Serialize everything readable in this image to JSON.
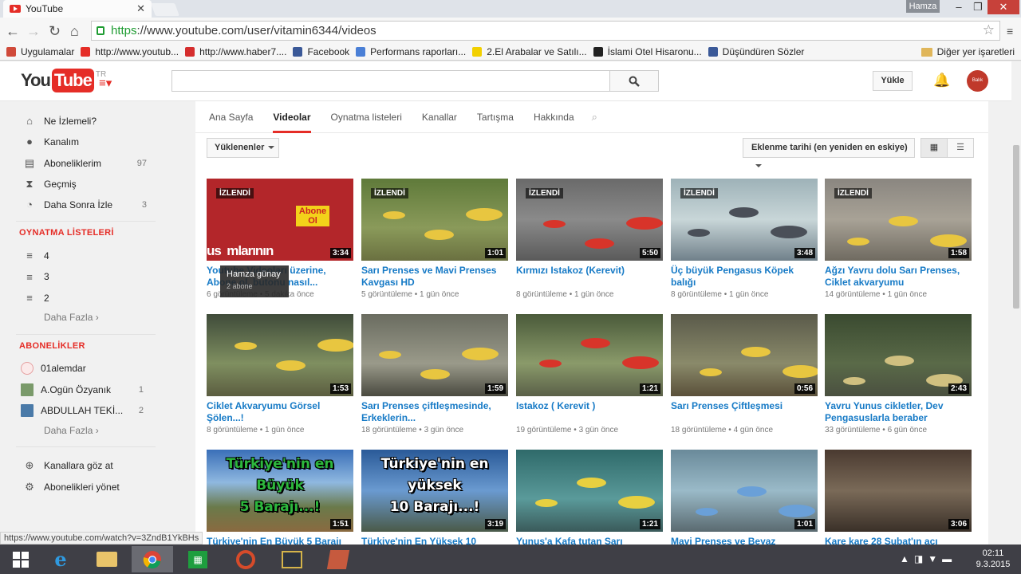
{
  "browser": {
    "tab_title": "YouTube",
    "tab_close": "✕",
    "user_badge": "Hamza",
    "url_https": "https",
    "url_rest": "://www.youtube.com/user/vitamin6344/videos",
    "bookmarks": [
      {
        "label": "Uygulamalar",
        "icon": "apps-icon",
        "color": "#d04a3a"
      },
      {
        "label": "http://www.youtub...",
        "icon": "youtube-icon",
        "color": "#e52d27"
      },
      {
        "label": "http://www.haber7....",
        "icon": "haber7-icon",
        "color": "#d52d2d"
      },
      {
        "label": "Facebook",
        "icon": "facebook-icon",
        "color": "#3b5998"
      },
      {
        "label": "Performans raporları...",
        "icon": "google-icon",
        "color": "#4a7fd6"
      },
      {
        "label": "2.El Arabalar ve Satılı...",
        "icon": "sahibinden-icon",
        "color": "#f2d000"
      },
      {
        "label": "İslami Otel Hisaronu...",
        "icon": "otel-icon",
        "color": "#222222"
      },
      {
        "label": "Düşündüren Sözler",
        "icon": "facebook-icon",
        "color": "#3b5998"
      }
    ],
    "other_bookmarks": "Diğer yer işaretleri",
    "status_url": "https://www.youtube.com/watch?v=3ZndB1YkBHs"
  },
  "masthead": {
    "logo_you": "You",
    "logo_tube": "Tube",
    "logo_region": "TR",
    "search_placeholder": "",
    "upload_label": "Yükle",
    "avatar_text": "Balık Videoları"
  },
  "guide": {
    "main_items": [
      {
        "label": "Ne İzlemeli?",
        "icon": "home-icon",
        "count": ""
      },
      {
        "label": "Kanalım",
        "icon": "user-icon",
        "count": ""
      },
      {
        "label": "Aboneliklerim",
        "icon": "subscriptions-icon",
        "count": "97"
      },
      {
        "label": "Geçmiş",
        "icon": "hourglass-icon",
        "count": ""
      },
      {
        "label": "Daha Sonra İzle",
        "icon": "clock-icon",
        "count": "3"
      }
    ],
    "playlists_header": "OYNATMA LİSTELERİ",
    "playlists": [
      {
        "label": "4"
      },
      {
        "label": "3"
      },
      {
        "label": "2"
      }
    ],
    "more_label": "Daha Fazla",
    "subscriptions_header": "ABONELİKLER",
    "subscriptions": [
      {
        "label": "01alemdar",
        "count": ""
      },
      {
        "label": "A.Ogün Özyanık",
        "count": "1"
      },
      {
        "label": "ABDULLAH TEKİ...",
        "count": "2"
      }
    ],
    "bottom_items": [
      {
        "label": "Kanallara göz at",
        "icon": "plus-circle-icon"
      },
      {
        "label": "Abonelikleri yönet",
        "icon": "gear-icon"
      }
    ]
  },
  "channel": {
    "tabs": [
      "Ana Sayfa",
      "Videolar",
      "Oynatma listeleri",
      "Kanallar",
      "Tartışma",
      "Hakkında"
    ],
    "active_tab": "Videolar",
    "uploads_dropdown": "Yüklenenler",
    "sort_dropdown": "Eklenme tarihi (en yeniden en eskiye)"
  },
  "tooltip": {
    "name": "Hamza günay",
    "subs": "2 abone",
    "button": "Abone Ol"
  },
  "thumb_text": {
    "v1_overlay": "us  mlarının",
    "v11_line1": "Türkiye'nin en",
    "v11_line2": "Büyük",
    "v11_line3": "5 Barajı...!",
    "v12_line1": "Türkiye'nin en",
    "v12_line2": "yüksek",
    "v12_line3": "10 Barajı...!"
  },
  "videos": [
    {
      "title": "Youtube Videoları üzerine, Abone ol, butonu nasıl...",
      "views": "6 görüntüleme",
      "age": "5 dakika önce",
      "duration": "3:34",
      "watched": "İZLENDİ"
    },
    {
      "title": "Sarı Prenses ve Mavi Prenses Kavgası HD",
      "views": "5 görüntüleme",
      "age": "1 gün önce",
      "duration": "1:01",
      "watched": "İZLENDİ"
    },
    {
      "title": "Kırmızı Istakoz (Kerevit)",
      "views": "8 görüntüleme",
      "age": "1 gün önce",
      "duration": "5:50",
      "watched": "İZLENDİ"
    },
    {
      "title": "Üç büyük Pengasus Köpek balığı",
      "views": "8 görüntüleme",
      "age": "1 gün önce",
      "duration": "3:48",
      "watched": "İZLENDİ"
    },
    {
      "title": "Ağzı Yavru dolu Sarı Prenses, Ciklet akvaryumu",
      "views": "14 görüntüleme",
      "age": "1 gün önce",
      "duration": "1:58",
      "watched": "İZLENDİ"
    },
    {
      "title": "Ciklet Akvaryumu Görsel Şölen...!",
      "views": "8 görüntüleme",
      "age": "1 gün önce",
      "duration": "1:53",
      "watched": ""
    },
    {
      "title": "Sarı Prenses çiftleşmesinde, Erkeklerin...",
      "views": "18 görüntüleme",
      "age": "3 gün önce",
      "duration": "1:59",
      "watched": ""
    },
    {
      "title": "Istakoz ( Kerevit )",
      "views": "19 görüntüleme",
      "age": "3 gün önce",
      "duration": "1:21",
      "watched": ""
    },
    {
      "title": "Sarı Prenses Çiftleşmesi",
      "views": "18 görüntüleme",
      "age": "4 gün önce",
      "duration": "0:56",
      "watched": ""
    },
    {
      "title": "Yavru Yunus cikletler, Dev Pengasuslarla beraber",
      "views": "33 görüntüleme",
      "age": "6 gün önce",
      "duration": "2:43",
      "watched": ""
    },
    {
      "title": "Türkiye'nin En Büyük 5 Barajı",
      "views": "",
      "age": "",
      "duration": "1:51",
      "watched": ""
    },
    {
      "title": "Türkiye'nin En Yüksek 10",
      "views": "",
      "age": "",
      "duration": "3:19",
      "watched": ""
    },
    {
      "title": "Yunus'a Kafa tutan Sarı",
      "views": "",
      "age": "",
      "duration": "1:21",
      "watched": ""
    },
    {
      "title": "Mavi Prenses ve Beyaz",
      "views": "",
      "age": "",
      "duration": "1:01",
      "watched": ""
    },
    {
      "title": "Kare kare 28 Şubat'ın acı",
      "views": "",
      "age": "",
      "duration": "3:06",
      "watched": ""
    }
  ],
  "taskbar": {
    "time": "02:11",
    "date": "9.3.2015"
  },
  "colors": {
    "brand": "#e52d27",
    "link": "#167ac6"
  }
}
